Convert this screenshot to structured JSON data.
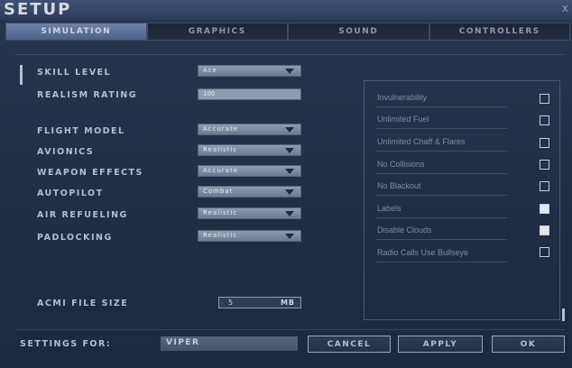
{
  "window": {
    "title": "SETUP",
    "close_glyph": "x"
  },
  "tabs": [
    {
      "label": "Simulation",
      "active": true
    },
    {
      "label": "Graphics",
      "active": false
    },
    {
      "label": "Sound",
      "active": false
    },
    {
      "label": "Controllers",
      "active": false
    }
  ],
  "skill": {
    "label": "Skill Level",
    "value": "Ace"
  },
  "realism": {
    "label": "Realism Rating",
    "value": "100"
  },
  "settings_rows": [
    {
      "label": "Flight Model",
      "value": "Accurate"
    },
    {
      "label": "Avionics",
      "value": "Realistic"
    },
    {
      "label": "Weapon Effects",
      "value": "Accurate"
    },
    {
      "label": "Autopilot",
      "value": "Combat"
    },
    {
      "label": "Air Refueling",
      "value": "Realistic"
    },
    {
      "label": "Padlocking",
      "value": "Realistic"
    }
  ],
  "options": [
    {
      "label": "Invulnerability",
      "checked": false
    },
    {
      "label": "Unlimited Fuel",
      "checked": false
    },
    {
      "label": "Unlimited Chaff & Flares",
      "checked": false
    },
    {
      "label": "No Collisions",
      "checked": false
    },
    {
      "label": "No Blackout",
      "checked": false
    },
    {
      "label": "Labels",
      "checked": true
    },
    {
      "label": "Disable Clouds",
      "checked": true
    },
    {
      "label": "Radio Calls Use Bullseye",
      "checked": false
    }
  ],
  "acmi": {
    "label": "ACMI File Size",
    "value": "5",
    "unit": "MB"
  },
  "footer": {
    "settings_for_label": "Settings for:",
    "settings_for_value": "VIPER",
    "cancel": "Cancel",
    "apply": "Apply",
    "ok": "Ok"
  }
}
